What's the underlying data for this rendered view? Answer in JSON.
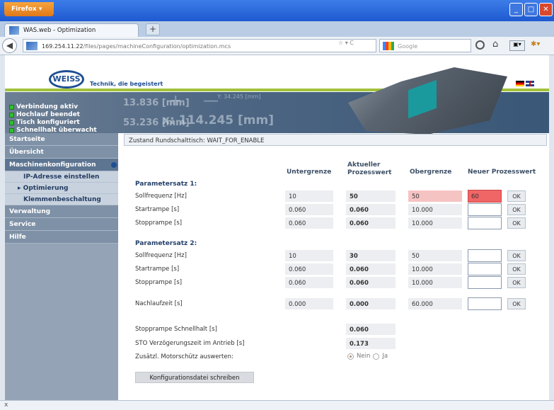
{
  "browser": {
    "app_button": "Firefox",
    "tab_title": "WAS.web - Optimization",
    "new_tab": "+",
    "url_host": "169.254.11.22",
    "url_path": "/files/pages/machineConfiguration/optimization.mcs",
    "search_placeholder": "Google",
    "statusbar_text": "x"
  },
  "header": {
    "logo_text": "WEISS",
    "tagline": "Technik, die begeistert"
  },
  "status": {
    "items": [
      "Verbindung aktiv",
      "Hochlauf beendet",
      "Tisch konfiguriert",
      "Schnellhalt überwacht"
    ],
    "led_color": "#30c030"
  },
  "banner": {
    "ghost_a": "13.836 [mm]",
    "ghost_b": "53.236 [mm]",
    "ghost_c": "x: 114.245 [mm]",
    "ghost_d": "Y: 34.245 [mm]"
  },
  "sidebar": {
    "items": [
      {
        "label": "Startseite"
      },
      {
        "label": "Übersicht"
      },
      {
        "label": "Maschinenkonfiguration"
      },
      {
        "label": "IP-Adresse einstellen"
      },
      {
        "label": "Optimierung"
      },
      {
        "label": "Klemmenbeschaltung"
      },
      {
        "label": "Verwaltung"
      },
      {
        "label": "Service"
      },
      {
        "label": "Hilfe"
      }
    ],
    "selected_marker": "▸"
  },
  "zustand": "Zustand Rundschalttisch:   WAIT_FOR_ENABLE",
  "columns": {
    "untergrenze": "Untergrenze",
    "aktuell": "Aktueller Prozesswert",
    "obergrenze": "Obergrenze",
    "neu": "Neuer Prozesswert"
  },
  "groups": {
    "p1": "Parametersatz 1:",
    "p2": "Parametersatz 2:"
  },
  "rows": {
    "p1_soll": {
      "label": "Sollfrequenz [Hz]",
      "min": "10",
      "cur": "50",
      "max": "50",
      "new": "60",
      "ok": "OK"
    },
    "p1_start": {
      "label": "Startrampe [s]",
      "min": "0.060",
      "cur": "0.060",
      "max": "10.000",
      "new": "",
      "ok": "OK"
    },
    "p1_stopp": {
      "label": "Stopprampe [s]",
      "min": "0.060",
      "cur": "0.060",
      "max": "10.000",
      "new": "",
      "ok": "OK"
    },
    "p2_soll": {
      "label": "Sollfrequenz [Hz]",
      "min": "10",
      "cur": "30",
      "max": "50",
      "new": "",
      "ok": "OK"
    },
    "p2_start": {
      "label": "Startrampe [s]",
      "min": "0.060",
      "cur": "0.060",
      "max": "10.000",
      "new": "",
      "ok": "OK"
    },
    "p2_stopp": {
      "label": "Stopprampe [s]",
      "min": "0.060",
      "cur": "0.060",
      "max": "10.000",
      "new": "",
      "ok": "OK"
    },
    "nachlauf": {
      "label": "Nachlaufzeit [s]",
      "min": "0.000",
      "cur": "0.000",
      "max": "60.000",
      "new": "",
      "ok": "OK"
    }
  },
  "extras": {
    "schnellhalt_label": "Stopprampe Schnellhalt [s]",
    "schnellhalt_value": "0.060",
    "sto_label": "STO Verzögerungszeit im Antrieb [s]",
    "sto_value": "0.173",
    "motor_label": "Zusätzl. Motorschütz auswerten:",
    "radio_nein": "Nein",
    "radio_ja": "Ja",
    "radio_selected": "Nein",
    "write_button": "Konfigurationsdatei schreiben"
  },
  "colors": {
    "over_limit_bg": "#f6c3c3",
    "error_input_bg": "#f06666"
  }
}
